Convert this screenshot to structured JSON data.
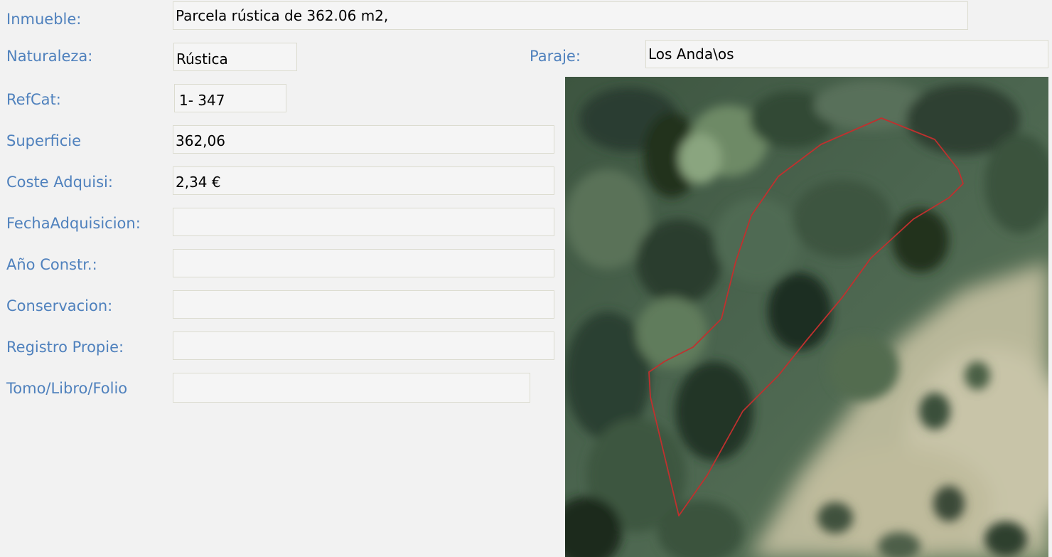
{
  "form": {
    "inmueble": {
      "label": "Inmueble:",
      "value": "Parcela rústica de 362.06 m2,"
    },
    "naturaleza": {
      "label": "Naturaleza:",
      "value": "Rústica"
    },
    "paraje": {
      "label": "Paraje:",
      "value": "Los Anda\\os"
    },
    "refcat": {
      "label": "RefCat:",
      "value": "1-  347"
    },
    "superficie": {
      "label": "Superficie",
      "value": "362,06"
    },
    "coste": {
      "label": "Coste Adquisi:",
      "value": "2,34 €"
    },
    "fecha": {
      "label": "FechaAdquisicion:",
      "value": ""
    },
    "anio": {
      "label": "Año Constr.:",
      "value": ""
    },
    "conservacion": {
      "label": "Conservacion:",
      "value": ""
    },
    "registro": {
      "label": "Registro Propie:",
      "value": ""
    },
    "tomo": {
      "label": "Tomo/Libro/Folio",
      "value": ""
    }
  },
  "aerial_photo": {
    "icon": "parcel-aerial-image",
    "outline_color": "#c0302e"
  }
}
